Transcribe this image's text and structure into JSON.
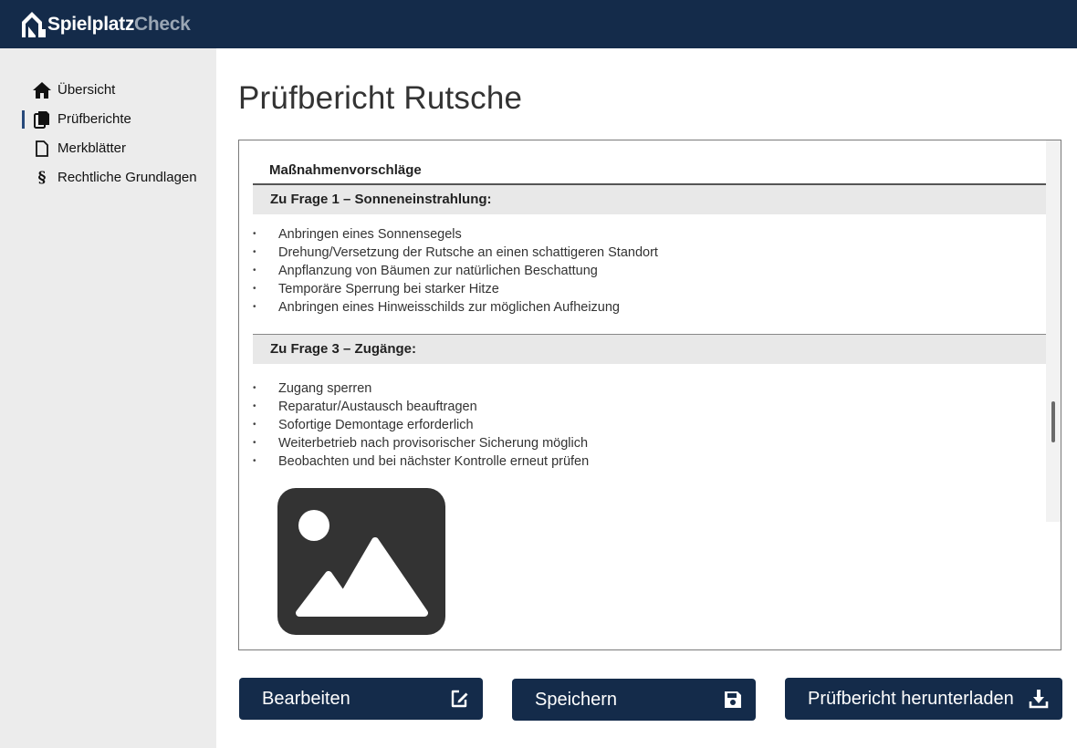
{
  "app": {
    "brand_part1": "Spielplatz",
    "brand_part2": "Check",
    "logo_icon": "house-logo-icon"
  },
  "sidebar": {
    "items": [
      {
        "label": "Übersicht",
        "icon": "home-icon",
        "active": false
      },
      {
        "label": "Prüfberichte",
        "icon": "documents-icon",
        "active": true
      },
      {
        "label": "Merkblätter",
        "icon": "file-icon",
        "active": false
      },
      {
        "label": "Rechtliche Grundlagen",
        "icon": "paragraph-icon",
        "active": false,
        "icon_glyph": "§"
      }
    ]
  },
  "page": {
    "title": "Prüfbericht Rutsche"
  },
  "document": {
    "section_heading": "Maßnahmenvorschläge",
    "questions": [
      {
        "title": "Zu Frage 1 – Sonneneinstrahlung:",
        "items": [
          "Anbringen eines Sonnensegels",
          "Drehung/Versetzung der Rutsche an einen schattigeren Standort",
          "Anpflanzung von Bäumen zur natürlichen Beschattung",
          "Temporäre Sperrung bei starker Hitze",
          "Anbringen eines Hinweisschilds zur möglichen Aufheizung"
        ]
      },
      {
        "title": "Zu Frage 3 – Zugänge:",
        "items": [
          "Zugang sperren",
          "Reparatur/Austausch beauftragen",
          "Sofortige Demontage erforderlich",
          "Weiterbetrieb nach provisorischer Sicherung möglich",
          "Beobachten und bei nächster Kontrolle erneut prüfen"
        ]
      }
    ],
    "bullet": "•",
    "image_icon": "image-placeholder-icon"
  },
  "actions": {
    "edit_label": "Bearbeiten",
    "save_label": "Speichern",
    "download_label": "Prüfbericht herunterladen"
  },
  "colors": {
    "primary": "#142b4a",
    "sidebar_bg": "#ececec",
    "active_marker": "#27497a"
  }
}
